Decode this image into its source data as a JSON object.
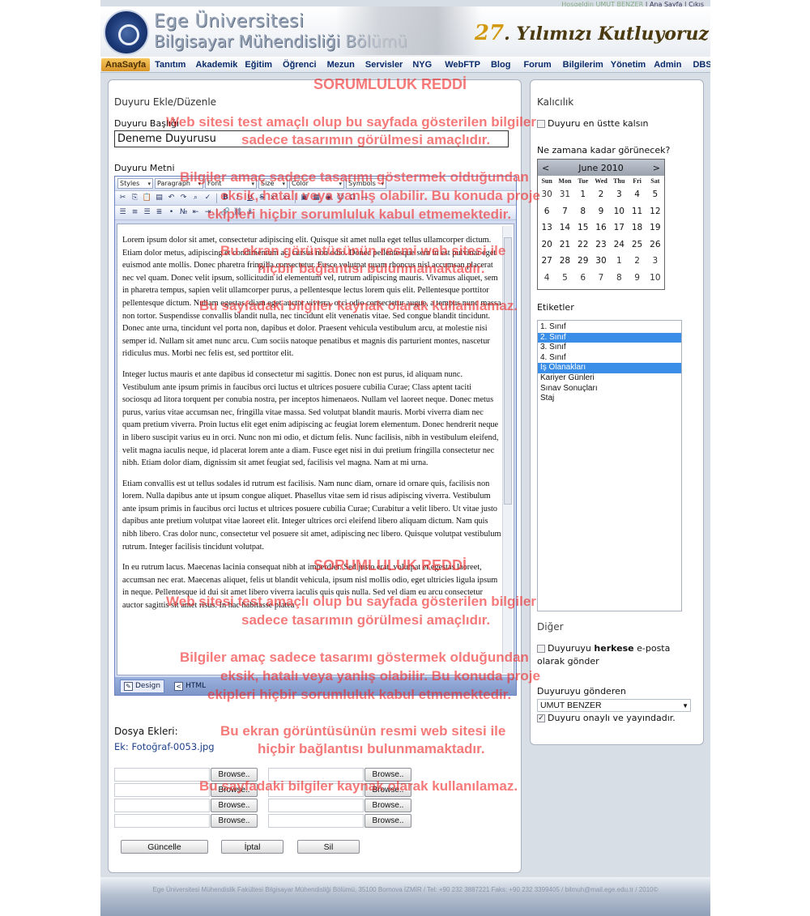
{
  "topbar": {
    "greeting": "Hoşgeldin",
    "user": "UMUT BENZER",
    "home": "Ana Sayfa",
    "logout": "Çıkış"
  },
  "banner": {
    "line1": "Ege Üniversitesi",
    "line2": "Bilgisayar Mühendisliği Bölümü",
    "years_num": "27",
    "years_text": ". Yılımızı Kutluyoruz"
  },
  "nav": [
    "AnaSayfa",
    "Tanıtım",
    "Akademik",
    "Eğitim",
    "Öğrenci",
    "Mezun",
    "Servisler",
    "NYG",
    "WebFTP",
    "Blog",
    "Forum",
    "Bilgilerim",
    "Yönetim",
    "Admin",
    "DBS"
  ],
  "main": {
    "title": "Duyuru Ekle/Düzenle",
    "subject_label": "Duyuru Başlığı",
    "subject_value": "Deneme Duyurusu",
    "body_label": "Duyuru Metni",
    "toolbar": {
      "styles": "Styles",
      "paragraph": "Paragraph",
      "font": "Font",
      "size": "Size",
      "color": "Color",
      "symbols": "Symbols"
    },
    "paragraphs": [
      "Lorem ipsum dolor sit amet, consectetur adipiscing elit. Quisque sit amet nulla eget tellus ullamcorper dictum. Etiam dolor metus, adipiscing et condimentum ac, cursus non odio. Donec pellentesque sem in est pulvinar eget euismod ante mollis. Donec pharetra fringilla consectetur. Fusce volutpat quam rhoncus nisl accumsan placerat nec vel quam. Donec velit ipsum, sollicitudin id elementum vel, rutrum adipiscing mauris. Vivamus aliquet, sem in pharetra tempus, sapien velit ullamcorper purus, a pellentesque lectus lorem quis elit. Pellentesque porttitor pellentesque dictum. Nullam egestas, diam eget auctor viverra, orci odio consectetur augue, a tempus nunc massa non tortor. Suspendisse convallis blandit nulla, nec tincidunt elit venenatis vitae. Sed congue blandit tincidunt. Donec ante urna, tincidunt vel porta non, dapibus et dolor. Praesent vehicula vestibulum arcu, at molestie nisi semper id. Nullam sit amet nunc arcu. Cum sociis natoque penatibus et magnis dis parturient montes, nascetur ridiculus mus. Morbi nec felis est, sed porttitor elit.",
      "Integer luctus mauris et ante dapibus id consectetur mi sagittis. Donec non est purus, id aliquam nunc. Vestibulum ante ipsum primis in faucibus orci luctus et ultrices posuere cubilia Curae; Class aptent taciti sociosqu ad litora torquent per conubia nostra, per inceptos himenaeos. Nullam vel laoreet neque. Donec metus purus, varius vitae accumsan nec, fringilla vitae massa. Sed volutpat blandit mauris. Morbi viverra diam nec quam pretium viverra. Proin luctus elit eget enim adipiscing ac feugiat lorem elementum. Donec hendrerit neque in libero suscipit varius eu in orci. Nunc non mi odio, et dictum felis. Nunc facilisis, nibh in vestibulum eleifend, velit magna iaculis neque, id placerat lorem ante a diam. Fusce eget nisi in dui pretium fringilla consectetur nec nibh. Etiam dolor diam, dignissim sit amet feugiat sed, facilisis vel magna. Nam at mi urna.",
      "Etiam convallis est ut tellus sodales id rutrum est facilisis. Nam nunc diam, ornare id ornare quis, facilisis non lorem. Nulla dapibus ante ut ipsum congue aliquet. Phasellus vitae sem id risus adipiscing viverra. Vestibulum ante ipsum primis in faucibus orci luctus et ultrices posuere cubilia Curae; Curabitur a velit libero. Ut vitae justo dapibus ante pretium volutpat vitae laoreet elit. Integer ultrices orci eleifend libero aliquam dictum. Nam quis nibh libero. Cras dolor nunc, consectetur vel posuere sit amet, adipiscing nec libero. Quisque volutpat vestibulum rutrum. Integer facilisis tincidunt volutpat.",
      "In eu rutrum lacus. Maecenas lacinia consequat nibh at imperdiet. Sed justo erat, volutpat et egestas laoreet, accumsan nec erat. Maecenas aliquet, felis ut blandit vehicula, ipsum nisl mollis odio, eget ultricies ligula ipsum in neque. Pellentesque id dui sit amet libero viverra iaculis quis quis nulla. Sed vel diam eu arcu consectetur auctor sagittis sit amet risus. In hac habitasse platea"
    ],
    "tab_design": "Design",
    "tab_html": "HTML",
    "attachments_label": "Dosya Ekleri:",
    "attachment_link": "Ek: Fotoğraf-0053.jpg",
    "browse_label": "Browse..",
    "btn_update": "Güncelle",
    "btn_cancel": "İptal",
    "btn_delete": "Sil"
  },
  "side": {
    "title": "Kalıcılık",
    "persist_label": "Duyuru en üstte kalsın",
    "until_label": "Ne zamana kadar görünecek?",
    "calendar": {
      "prev": "<",
      "next": ">",
      "month": "June 2010",
      "dow": [
        "Sun",
        "Mon",
        "Tue",
        "Wed",
        "Thu",
        "Fri",
        "Sat"
      ],
      "days": [
        "30",
        "31",
        "1",
        "2",
        "3",
        "4",
        "5",
        "6",
        "7",
        "8",
        "9",
        "10",
        "11",
        "12",
        "13",
        "14",
        "15",
        "16",
        "17",
        "18",
        "19",
        "20",
        "21",
        "22",
        "23",
        "24",
        "25",
        "26",
        "27",
        "28",
        "29",
        "30",
        "1",
        "2",
        "3",
        "4",
        "5",
        "6",
        "7",
        "8",
        "9",
        "10"
      ]
    },
    "tags_label": "Etiketler",
    "tags": [
      "1. Sınıf",
      "2. Sınıf",
      "3. Sınıf",
      "4. Sınıf",
      "İş Olanakları",
      "Kariyer Günleri",
      "Sınav Sonuçları",
      "Staj"
    ],
    "tags_selected": [
      "2. Sınıf",
      "İş Olanakları"
    ],
    "other_title": "Diğer",
    "everyone_pre": "Duyuruyu ",
    "everyone_bold": "herkese",
    "everyone_post": " e-posta olarak gönder",
    "sender_label": "Duyuruyu gönderen",
    "sender_value": "UMUT BENZER",
    "approved_label": "Duyuru onaylı ve yayındadır."
  },
  "footer": "Ege Üniversitesi Mühendislik Fakültesi Bilgisayar Mühendisliği Bölümü, 35100 Bornova İZMİR / Tel: +90 232 3887221 Faks: +90 232 3399405 / bilmuh@mail.ege.edu.tr / 2010©",
  "disclaimer": {
    "title": "SORUMLULUK REDDİ",
    "lines": [
      "Web sitesi test amaçlı olup bu sayfada gösterilen bilgiler",
      "sadece tasarımın görülmesi amaçlıdır.",
      "Bilgiler amaç sadece tasarımı göstermek olduğundan",
      "eksik, hatalı veya yanlış olabilir. Bu konuda proje",
      "ekipleri hiçbir sorumluluk kabul etmemektedir.",
      "Bu ekran görüntüsünün resmi web sitesi ile",
      "hiçbir bağlantısı bulunmamaktadır.",
      "Bu sayfadaki bilgiler kaynak olarak kullanılamaz."
    ]
  }
}
